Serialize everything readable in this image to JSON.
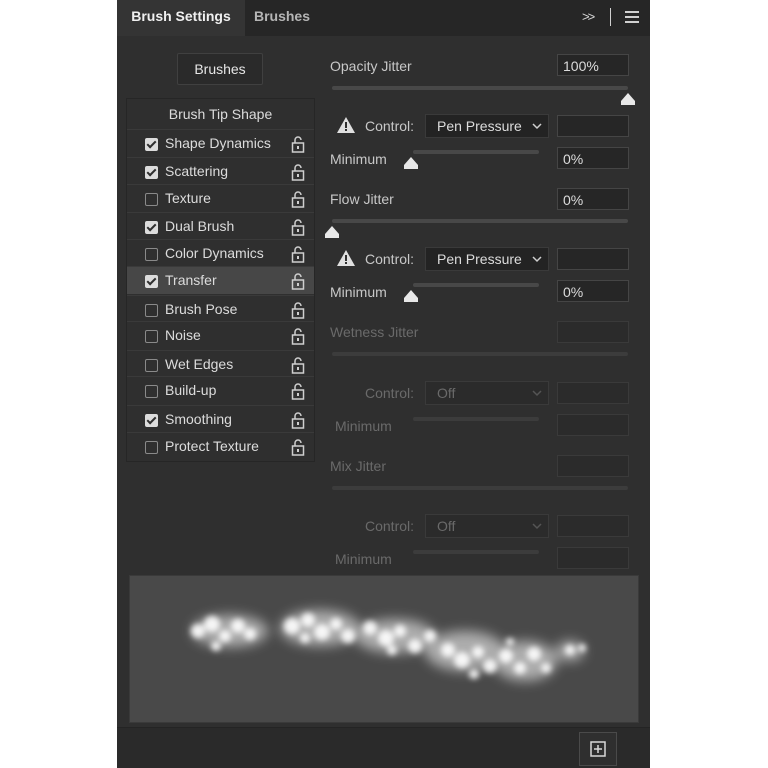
{
  "tabs": [
    {
      "label": "Brush Settings",
      "active": true
    },
    {
      "label": "Brushes",
      "active": false
    }
  ],
  "header_icons": {
    "expand": "double-chevron-right-icon",
    "menu": "hamburger-menu-icon"
  },
  "brushes_button": "Brushes",
  "brush_tip_shape": "Brush Tip Shape",
  "options": [
    {
      "label": "Shape Dynamics",
      "checked": true,
      "active": false
    },
    {
      "label": "Scattering",
      "checked": true,
      "active": false
    },
    {
      "label": "Texture",
      "checked": false,
      "active": false
    },
    {
      "label": "Dual Brush",
      "checked": true,
      "active": false
    },
    {
      "label": "Color Dynamics",
      "checked": false,
      "active": false
    },
    {
      "label": "Transfer",
      "checked": true,
      "active": true
    },
    {
      "label": "Brush Pose",
      "checked": false,
      "active": false
    },
    {
      "label": "Noise",
      "checked": false,
      "active": false
    },
    {
      "label": "Wet Edges",
      "checked": false,
      "active": false
    },
    {
      "label": "Build-up",
      "checked": false,
      "active": false
    },
    {
      "label": "Smoothing",
      "checked": true,
      "active": false
    },
    {
      "label": "Protect Texture",
      "checked": false,
      "active": false
    }
  ],
  "transfer": {
    "opacity_jitter": {
      "label": "Opacity Jitter",
      "value": "100%",
      "level": 1.0
    },
    "opacity_control": {
      "label": "Control:",
      "value": "Pen Pressure"
    },
    "opacity_minimum": {
      "label": "Minimum",
      "value": "0%",
      "level": 0.0
    },
    "flow_jitter": {
      "label": "Flow Jitter",
      "value": "0%",
      "level": 0.0
    },
    "flow_control": {
      "label": "Control:",
      "value": "Pen Pressure"
    },
    "flow_minimum": {
      "label": "Minimum",
      "value": "0%",
      "level": 0.0
    },
    "wetness_jitter": {
      "label": "Wetness Jitter"
    },
    "wetness_control": {
      "label": "Control:",
      "value": "Off"
    },
    "wetness_minimum": {
      "label": "Minimum"
    },
    "mix_jitter": {
      "label": "Mix Jitter"
    },
    "mix_control": {
      "label": "Control:",
      "value": "Off"
    },
    "mix_minimum": {
      "label": "Minimum"
    }
  },
  "colors": {
    "panel": "#2f2f2f",
    "tabbar": "#262626",
    "active_row": "#474747",
    "preview": "#494949"
  }
}
